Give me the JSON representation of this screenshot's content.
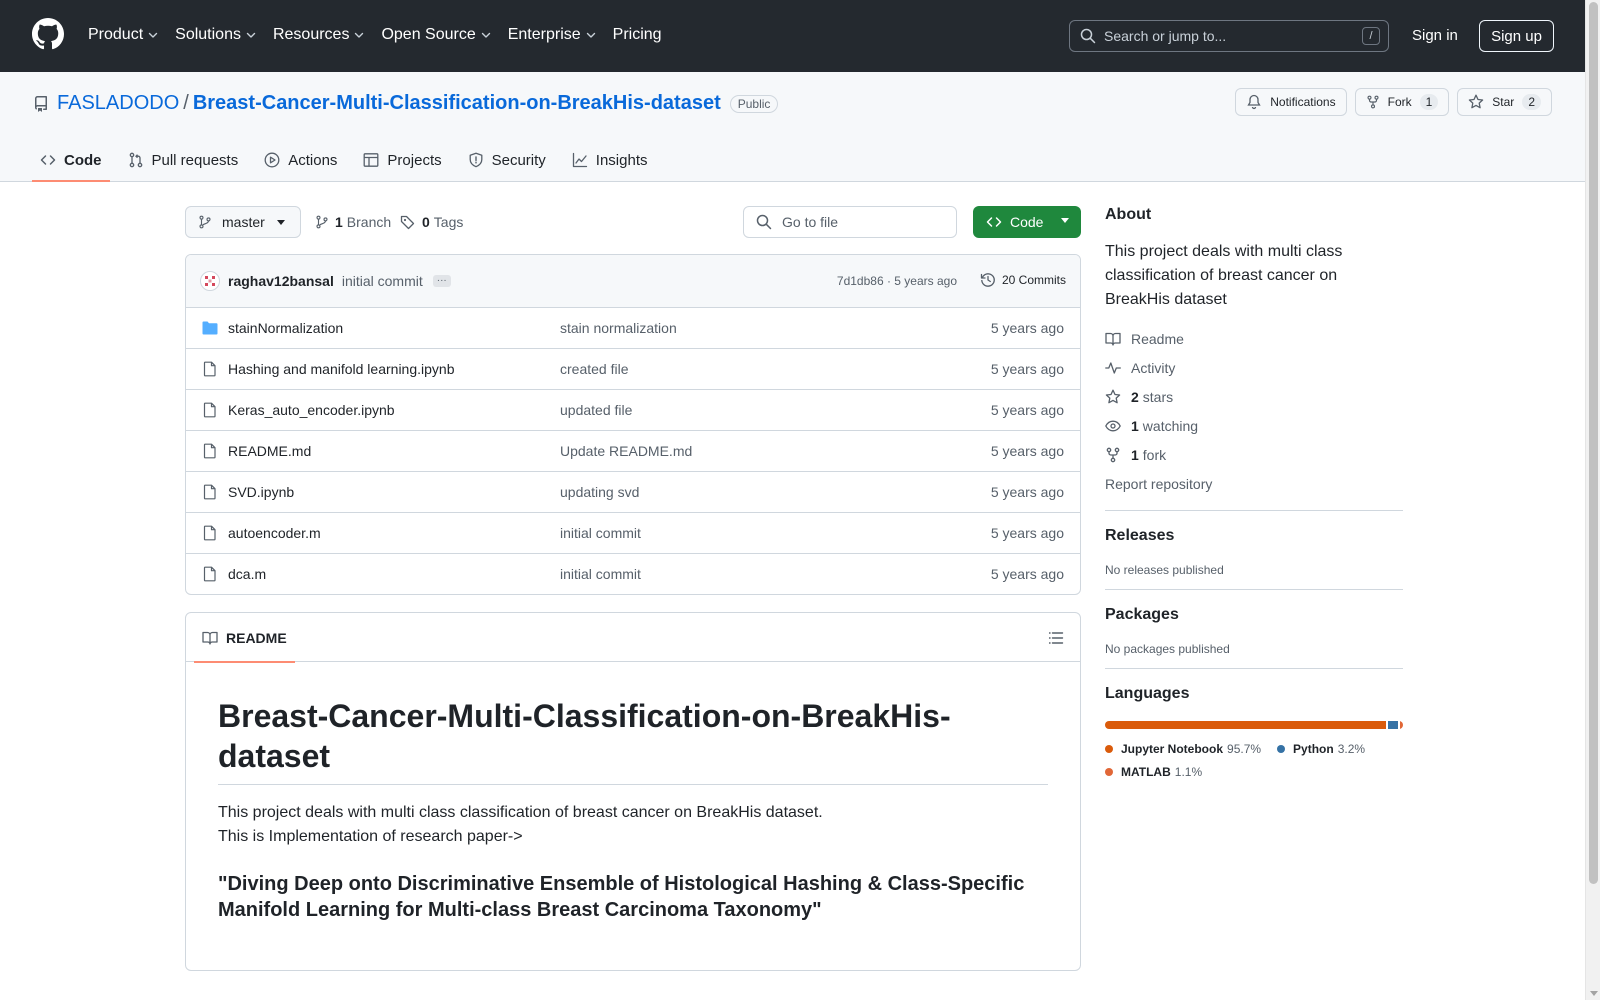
{
  "header": {
    "nav": [
      {
        "label": "Product",
        "has_menu": true
      },
      {
        "label": "Solutions",
        "has_menu": true
      },
      {
        "label": "Resources",
        "has_menu": true
      },
      {
        "label": "Open Source",
        "has_menu": true
      },
      {
        "label": "Enterprise",
        "has_menu": true
      },
      {
        "label": "Pricing",
        "has_menu": false
      }
    ],
    "search_placeholder": "Search or jump to...",
    "search_shortcut": "/",
    "sign_in": "Sign in",
    "sign_up": "Sign up"
  },
  "repo": {
    "owner": "FASLADODO",
    "separator": "/",
    "name": "Breast-Cancer-Multi-Classification-on-BreakHis-dataset",
    "visibility": "Public",
    "notifications_label": "Notifications",
    "fork_label": "Fork",
    "fork_count": "1",
    "star_label": "Star",
    "star_count": "2"
  },
  "tabs": [
    {
      "label": "Code",
      "icon": "code-icon",
      "active": true
    },
    {
      "label": "Pull requests",
      "icon": "pull-request-icon",
      "active": false
    },
    {
      "label": "Actions",
      "icon": "play-icon",
      "active": false
    },
    {
      "label": "Projects",
      "icon": "table-icon",
      "active": false
    },
    {
      "label": "Security",
      "icon": "shield-icon",
      "active": false
    },
    {
      "label": "Insights",
      "icon": "graph-icon",
      "active": false
    }
  ],
  "toolbar": {
    "branch": "master",
    "branches_count": "1",
    "branches_label": "Branch",
    "tags_count": "0",
    "tags_label": "Tags",
    "goto_placeholder": "Go to file",
    "code_button": "Code"
  },
  "commit": {
    "author": "raghav12bansal",
    "message": "initial commit",
    "hash_time": "7d1db86 · 5 years ago",
    "commits_label": "20 Commits"
  },
  "files": [
    {
      "name": "stainNormalization",
      "type": "folder",
      "message": "stain normalization",
      "date": "5 years ago"
    },
    {
      "name": "Hashing and manifold learning.ipynb",
      "type": "file",
      "message": "created file",
      "date": "5 years ago"
    },
    {
      "name": "Keras_auto_encoder.ipynb",
      "type": "file",
      "message": "updated file",
      "date": "5 years ago"
    },
    {
      "name": "README.md",
      "type": "file",
      "message": "Update README.md",
      "date": "5 years ago"
    },
    {
      "name": "SVD.ipynb",
      "type": "file",
      "message": "updating svd",
      "date": "5 years ago"
    },
    {
      "name": "autoencoder.m",
      "type": "file",
      "message": "initial commit",
      "date": "5 years ago"
    },
    {
      "name": "dca.m",
      "type": "file",
      "message": "initial commit",
      "date": "5 years ago"
    }
  ],
  "readme": {
    "tab_label": "README",
    "title": "Breast-Cancer-Multi-Classification-on-BreakHis-dataset",
    "line1": "This project deals with multi class classification of breast cancer on BreakHis dataset.",
    "line2": "This is Implementation of research paper->",
    "paper_title": "\"Diving Deep onto Discriminative Ensemble of Histological Hashing & Class-Specific Manifold Learning for Multi-class Breast Carcinoma Taxonomy\""
  },
  "sidebar": {
    "about_title": "About",
    "about_text": "This project deals with multi class classification of breast cancer on BreakHis dataset",
    "readme_label": "Readme",
    "activity_label": "Activity",
    "stars_count": "2",
    "stars_label": "stars",
    "watching_count": "1",
    "watching_label": "watching",
    "forks_count": "1",
    "forks_label": "fork",
    "report_label": "Report repository",
    "releases_title": "Releases",
    "releases_text": "No releases published",
    "packages_title": "Packages",
    "packages_text": "No packages published",
    "languages_title": "Languages",
    "languages": [
      {
        "name": "Jupyter Notebook",
        "percent": "95.7%",
        "value": 95.7,
        "color": "#DA5B0B"
      },
      {
        "name": "Python",
        "percent": "3.2%",
        "value": 3.2,
        "color": "#3572A5"
      },
      {
        "name": "MATLAB",
        "percent": "1.1%",
        "value": 1.1,
        "color": "#e16737"
      }
    ]
  }
}
